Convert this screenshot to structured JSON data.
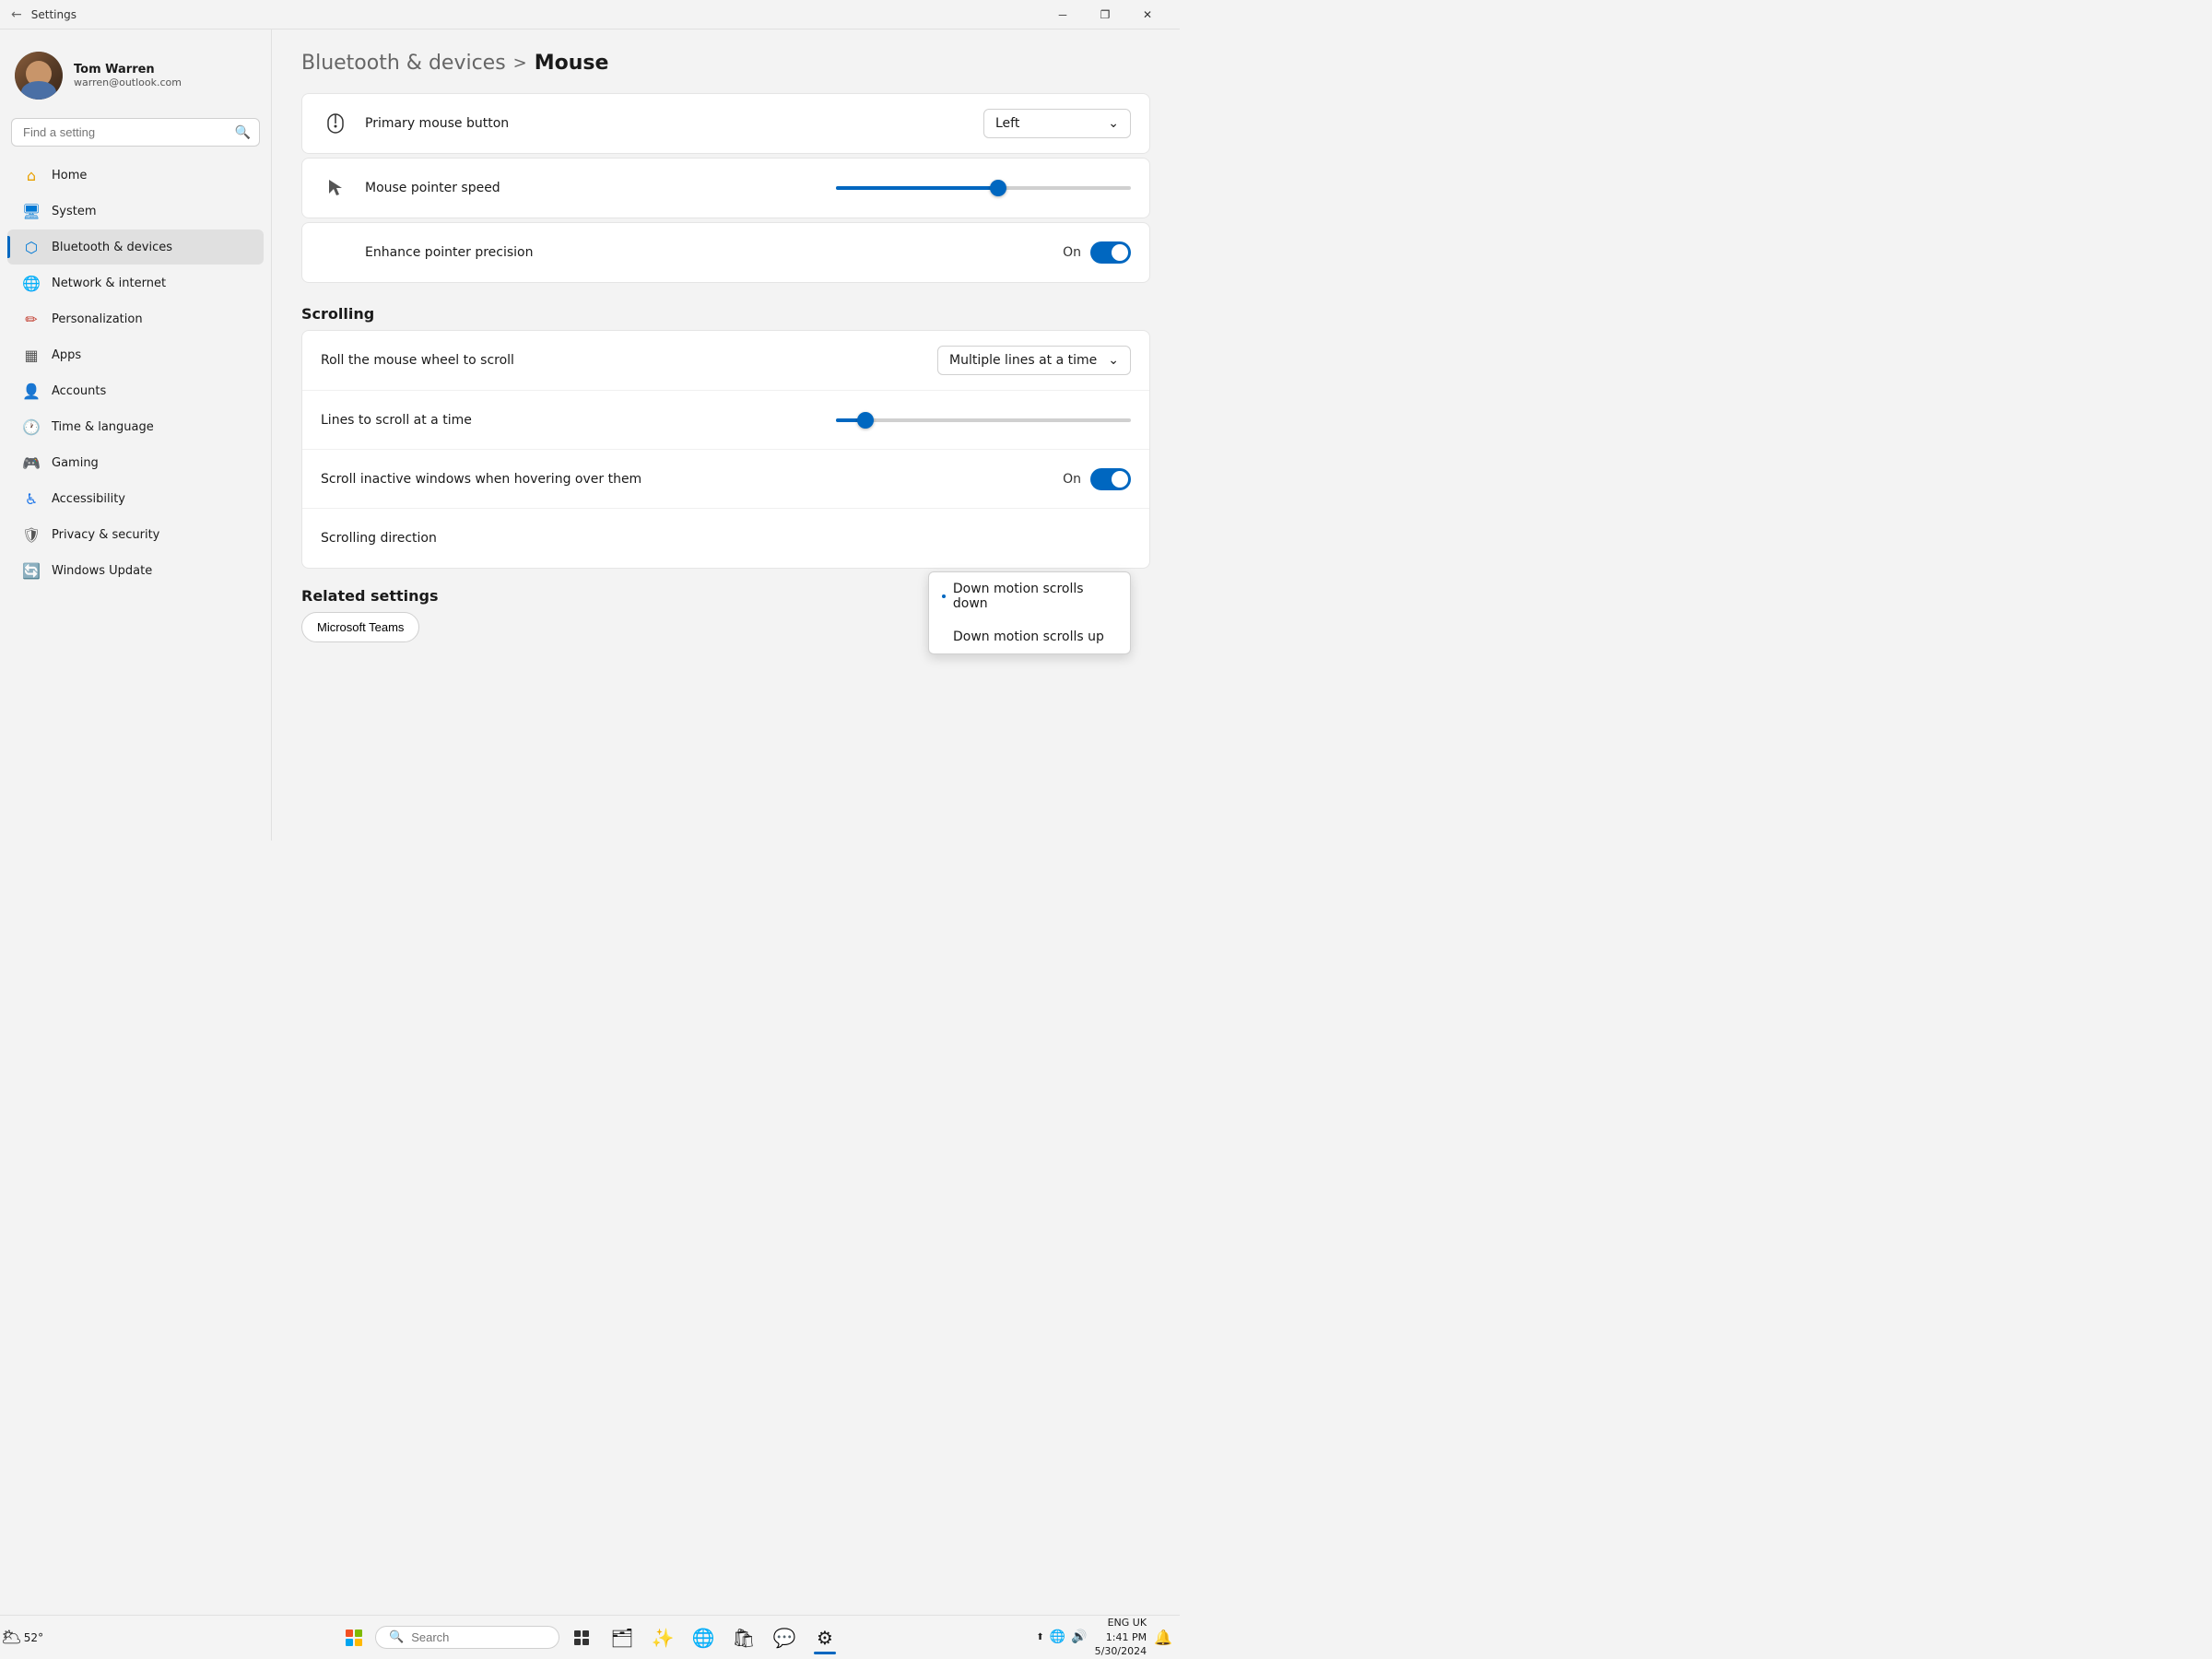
{
  "titlebar": {
    "title": "Settings",
    "minimize": "─",
    "maximize": "❐",
    "close": "✕"
  },
  "profile": {
    "name": "Tom Warren",
    "email": "warren@outlook.com"
  },
  "search": {
    "placeholder": "Find a setting"
  },
  "nav": {
    "items": [
      {
        "id": "home",
        "label": "Home",
        "icon": "⌂",
        "iconClass": "icon-home"
      },
      {
        "id": "system",
        "label": "System",
        "icon": "🖥",
        "iconClass": "icon-system"
      },
      {
        "id": "bluetooth",
        "label": "Bluetooth & devices",
        "icon": "⬡",
        "iconClass": "icon-bluetooth",
        "active": true
      },
      {
        "id": "network",
        "label": "Network & internet",
        "icon": "🌐",
        "iconClass": "icon-network"
      },
      {
        "id": "personalization",
        "label": "Personalization",
        "icon": "✏",
        "iconClass": "icon-personalization"
      },
      {
        "id": "apps",
        "label": "Apps",
        "icon": "▦",
        "iconClass": "icon-apps"
      },
      {
        "id": "accounts",
        "label": "Accounts",
        "icon": "👤",
        "iconClass": "icon-accounts"
      },
      {
        "id": "time",
        "label": "Time & language",
        "icon": "🕐",
        "iconClass": "icon-time"
      },
      {
        "id": "gaming",
        "label": "Gaming",
        "icon": "🎮",
        "iconClass": "icon-gaming"
      },
      {
        "id": "accessibility",
        "label": "Accessibility",
        "icon": "♿",
        "iconClass": "icon-accessibility"
      },
      {
        "id": "privacy",
        "label": "Privacy & security",
        "icon": "🛡",
        "iconClass": "icon-privacy"
      },
      {
        "id": "update",
        "label": "Windows Update",
        "icon": "🔄",
        "iconClass": "icon-update"
      }
    ]
  },
  "breadcrumb": {
    "parent": "Bluetooth & devices",
    "separator": ">",
    "current": "Mouse"
  },
  "settings": {
    "primaryMouseButton": {
      "label": "Primary mouse button",
      "value": "Left"
    },
    "pointerSpeed": {
      "label": "Mouse pointer speed",
      "fillPercent": 55
    },
    "enhancePrecision": {
      "label": "Enhance pointer precision",
      "state": "On"
    },
    "scrollingSection": "Scrolling",
    "rollMouseWheel": {
      "label": "Roll the mouse wheel to scroll",
      "value": "Multiple lines at a time"
    },
    "linesToScroll": {
      "label": "Lines to scroll at a time",
      "fillPercent": 10
    },
    "scrollInactive": {
      "label": "Scroll inactive windows when hovering over them",
      "state": "On"
    },
    "scrollDirection": {
      "label": "Scrolling direction",
      "options": [
        {
          "label": "Down motion scrolls down",
          "selected": true
        },
        {
          "label": "Down motion scrolls up",
          "selected": false
        }
      ]
    }
  },
  "relatedSettings": {
    "header": "Related settings",
    "button": "Microsoft Teams"
  },
  "taskbar": {
    "searchPlaceholder": "Search",
    "weather": "52°",
    "time": "1:41 PM",
    "date": "5/30/2024",
    "locale": "ENG\nUK"
  }
}
